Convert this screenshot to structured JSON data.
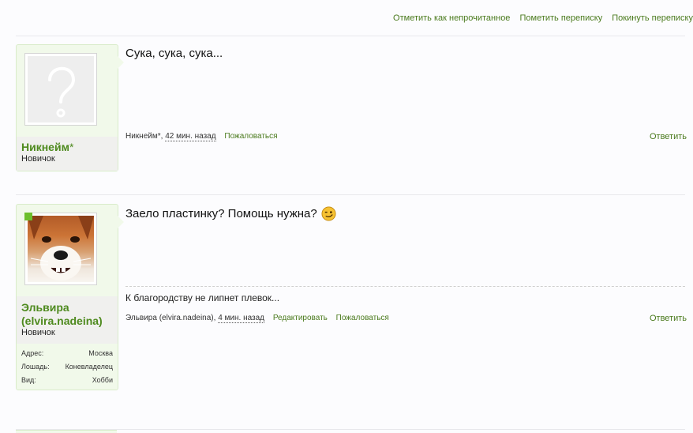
{
  "top_actions": {
    "mark_unread": "Отметить как непрочитанное",
    "mark_conversation": "Пометить переписку",
    "leave_conversation": "Покинуть переписку"
  },
  "posts": [
    {
      "user": {
        "name": "Никнейм",
        "suffix": "*",
        "rank": "Новичок",
        "avatar": "question-mark-avatar"
      },
      "message": "Сука, сука, сука...",
      "meta": {
        "author": "Никнейм*,",
        "time": "42 мин. назад",
        "report": "Пожаловаться"
      },
      "reply": "Ответить"
    },
    {
      "user": {
        "name": "Эльвира (elvira.nadeina)",
        "rank": "Новичок",
        "avatar": "fox-photo-avatar",
        "fields": [
          {
            "label": "Адрес:",
            "value": "Москва"
          },
          {
            "label": "Лошадь:",
            "value": "Коневладелец"
          },
          {
            "label": "Вид:",
            "value": "Хобби"
          }
        ]
      },
      "message": "Заело пластинку? Помощь нужна?",
      "emoji": "wink-smiley-icon",
      "signature": "К благородству не липнет плевок...",
      "meta": {
        "author": "Эльвира (elvira.nadeina),",
        "time": "4 мин. назад",
        "edit": "Редактировать",
        "report": "Пожаловаться"
      },
      "reply": "Ответить"
    }
  ],
  "colors": {
    "accent": "#4a7a1d",
    "username": "#4e8a1e",
    "card_bg": "#f1f9ea"
  }
}
